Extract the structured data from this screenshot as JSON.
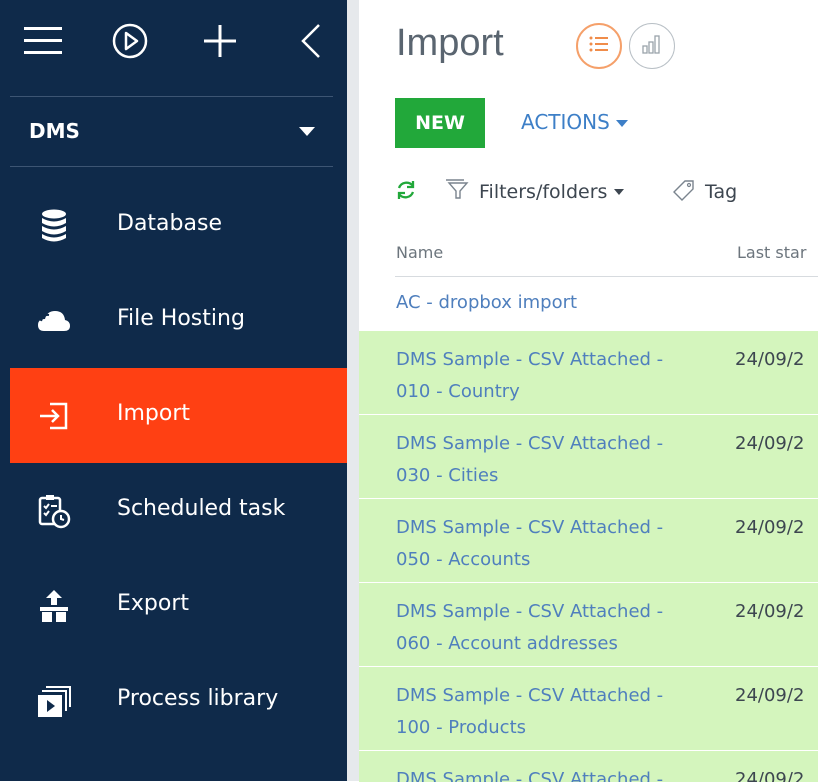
{
  "sidebar": {
    "selector_label": "DMS",
    "items": [
      {
        "label": "Database",
        "icon": "database-icon",
        "active": false
      },
      {
        "label": "File Hosting",
        "icon": "cloud-icon",
        "active": false
      },
      {
        "label": "Import",
        "icon": "import-icon",
        "active": true
      },
      {
        "label": "Scheduled task",
        "icon": "scheduled-task-icon",
        "active": false
      },
      {
        "label": "Export",
        "icon": "export-icon",
        "active": false
      },
      {
        "label": "Process library",
        "icon": "process-library-icon",
        "active": false
      }
    ]
  },
  "main": {
    "title": "Import",
    "new_label": "NEW",
    "actions_label": "ACTIONS",
    "filters_label": "Filters/folders",
    "tag_label": "Tag",
    "columns": [
      "Name",
      "Last star"
    ],
    "rows": [
      {
        "name": "AC - dropbox import",
        "date": ""
      },
      {
        "name": "DMS Sample - CSV Attached - 010 - Country",
        "date": "24/09/2"
      },
      {
        "name": "DMS Sample - CSV Attached - 030 - Cities",
        "date": "24/09/2"
      },
      {
        "name": "DMS Sample - CSV Attached - 050 - Accounts",
        "date": "24/09/2"
      },
      {
        "name": "DMS Sample - CSV Attached - 060 - Account addresses",
        "date": "24/09/2"
      },
      {
        "name": "DMS Sample - CSV Attached - 100 - Products",
        "date": "24/09/2"
      },
      {
        "name": "DMS Sample - CSV Attached -",
        "date": "24/09/2"
      }
    ]
  },
  "colors": {
    "sidebar_bg": "#0f2a4a",
    "active_bg": "#ff4013",
    "new_button": "#22a83a",
    "link": "#4f7fbd",
    "row_highlight": "#d4f5bd"
  }
}
